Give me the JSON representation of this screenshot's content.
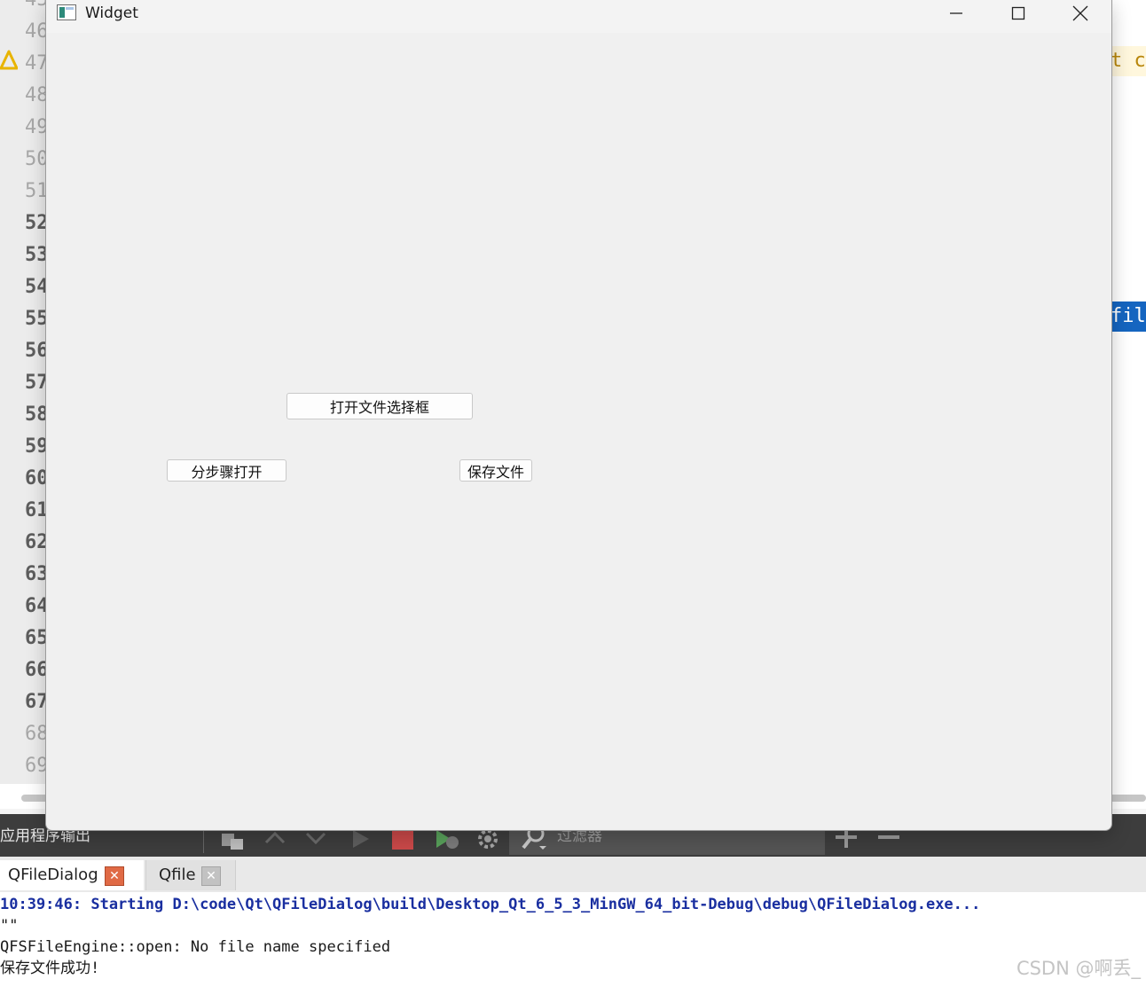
{
  "ide": {
    "line_numbers": [
      {
        "n": "46",
        "current": false
      },
      {
        "n": "47",
        "current": false
      },
      {
        "n": "48",
        "current": false
      },
      {
        "n": "49",
        "current": false
      },
      {
        "n": "50",
        "current": false
      },
      {
        "n": "51",
        "current": false
      },
      {
        "n": "52",
        "current": true
      },
      {
        "n": "53",
        "current": true
      },
      {
        "n": "54",
        "current": true
      },
      {
        "n": "55",
        "current": true
      },
      {
        "n": "56",
        "current": true
      },
      {
        "n": "57",
        "current": true
      },
      {
        "n": "58",
        "current": true
      },
      {
        "n": "59",
        "current": true
      },
      {
        "n": "60",
        "current": true
      },
      {
        "n": "61",
        "current": true
      },
      {
        "n": "62",
        "current": true
      },
      {
        "n": "63",
        "current": true
      },
      {
        "n": "64",
        "current": true
      },
      {
        "n": "65",
        "current": true
      },
      {
        "n": "66",
        "current": true
      },
      {
        "n": "67",
        "current": true
      },
      {
        "n": "68",
        "current": false
      },
      {
        "n": "69",
        "current": false
      }
    ],
    "code_fragment_1": "t c",
    "code_fragment_2": "fil",
    "warning_icon": "warning-triangle-icon"
  },
  "widget_window": {
    "title": "Widget",
    "buttons": {
      "open_dialog": "打开文件选择框",
      "step_open": "分步骤打开",
      "save_file": "保存文件"
    }
  },
  "output_pane": {
    "title": "应用程序输出",
    "filter_placeholder": "过滤器",
    "tabs": [
      {
        "label": "QFileDialog",
        "active": true
      },
      {
        "label": "Qfile",
        "active": false
      }
    ],
    "lines": [
      {
        "text": "10:39:46: Starting D:\\code\\Qt\\QFileDialog\\build\\Desktop_Qt_6_5_3_MinGW_64_bit-Debug\\debug\\QFileDialog.exe...",
        "style": "start"
      },
      {
        "text": "\"\"",
        "style": "normal"
      },
      {
        "text": "QFSFileEngine::open: No file name specified",
        "style": "normal"
      },
      {
        "text": "保存文件成功!",
        "style": "normal"
      }
    ]
  },
  "watermark": "CSDN @啊丢_",
  "colors": {
    "accent_selection": "#1565c0",
    "close_tab_active": "#e06a45",
    "run_output_blue": "#1a2fa0",
    "stop_red": "#c94848"
  }
}
